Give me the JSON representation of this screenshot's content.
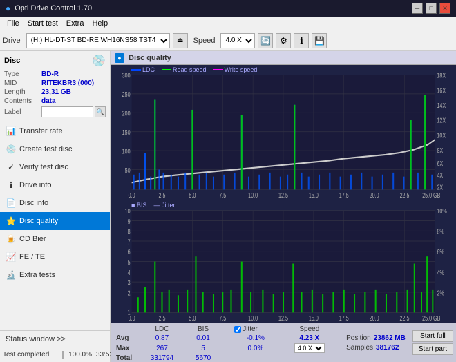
{
  "app": {
    "title": "Opti Drive Control 1.70",
    "title_icon": "●"
  },
  "titlebar": {
    "minimize": "─",
    "maximize": "□",
    "close": "✕"
  },
  "menubar": {
    "items": [
      "File",
      "Start test",
      "Extra",
      "Help"
    ]
  },
  "toolbar": {
    "drive_label": "Drive",
    "drive_value": "(H:)  HL-DT-ST BD-RE  WH16NS58 TST4",
    "speed_label": "Speed",
    "speed_value": "4.0 X"
  },
  "disc": {
    "title": "Disc",
    "type_label": "Type",
    "type_value": "BD-R",
    "mid_label": "MID",
    "mid_value": "RITEKBR3 (000)",
    "length_label": "Length",
    "length_value": "23,31 GB",
    "contents_label": "Contents",
    "contents_value": "data",
    "label_label": "Label",
    "label_value": ""
  },
  "nav": {
    "items": [
      {
        "id": "transfer-rate",
        "label": "Transfer rate",
        "icon": "📊"
      },
      {
        "id": "create-test-disc",
        "label": "Create test disc",
        "icon": "💿"
      },
      {
        "id": "verify-test-disc",
        "label": "Verify test disc",
        "icon": "✓"
      },
      {
        "id": "drive-info",
        "label": "Drive info",
        "icon": "ℹ"
      },
      {
        "id": "disc-info",
        "label": "Disc info",
        "icon": "📄"
      },
      {
        "id": "disc-quality",
        "label": "Disc quality",
        "icon": "⭐",
        "active": true
      },
      {
        "id": "cd-bier",
        "label": "CD Bier",
        "icon": "🍺"
      },
      {
        "id": "fe-te",
        "label": "FE / TE",
        "icon": "📈"
      },
      {
        "id": "extra-tests",
        "label": "Extra tests",
        "icon": "🔬"
      }
    ]
  },
  "status_window": {
    "label": "Status window >>",
    "chevrons": ">>"
  },
  "chart": {
    "title": "Disc quality",
    "legend": {
      "ldc_label": "LDC",
      "ldc_color": "#0000ff",
      "read_label": "Read speed",
      "read_color": "#00ff00",
      "write_label": "Write speed",
      "write_color": "#ff00ff"
    },
    "upper": {
      "y_max": 300,
      "y_labels": [
        "300",
        "250",
        "200",
        "150",
        "100",
        "50"
      ],
      "y_right_labels": [
        "18X",
        "16X",
        "14X",
        "12X",
        "10X",
        "8X",
        "6X",
        "4X",
        "2X"
      ],
      "x_labels": [
        "0.0",
        "2.5",
        "5.0",
        "7.5",
        "10.0",
        "12.5",
        "15.0",
        "17.5",
        "20.0",
        "22.5",
        "25.0 GB"
      ]
    },
    "lower": {
      "title": "BIS",
      "subtitle": "Jitter",
      "y_labels": [
        "10",
        "9",
        "8",
        "7",
        "6",
        "5",
        "4",
        "3",
        "2",
        "1"
      ],
      "y_right_labels": [
        "10%",
        "8%",
        "6%",
        "4%",
        "2%"
      ],
      "x_labels": [
        "0.0",
        "2.5",
        "5.0",
        "7.5",
        "10.0",
        "12.5",
        "15.0",
        "17.5",
        "20.0",
        "22.5",
        "25.0 GB"
      ]
    }
  },
  "stats": {
    "columns": [
      "LDC",
      "BIS",
      "",
      "Jitter",
      "Speed"
    ],
    "jitter_checked": true,
    "jitter_label": "Jitter",
    "speed_label": "Speed",
    "speed_value": "4.23 X",
    "speed_dropdown": "4.0 X",
    "rows": [
      {
        "label": "Avg",
        "ldc": "0.87",
        "bis": "0.01",
        "jitter": "-0.1%"
      },
      {
        "label": "Max",
        "ldc": "267",
        "bis": "5",
        "jitter": "0.0%"
      },
      {
        "label": "Total",
        "ldc": "331794",
        "bis": "5670",
        "jitter": ""
      }
    ],
    "position_label": "Position",
    "position_value": "23862 MB",
    "samples_label": "Samples",
    "samples_value": "381762"
  },
  "buttons": {
    "start_full": "Start full",
    "start_part": "Start part"
  },
  "progress": {
    "percent": 100.0,
    "percent_text": "100.0%",
    "time": "33:52",
    "status_text": "Test completed"
  }
}
